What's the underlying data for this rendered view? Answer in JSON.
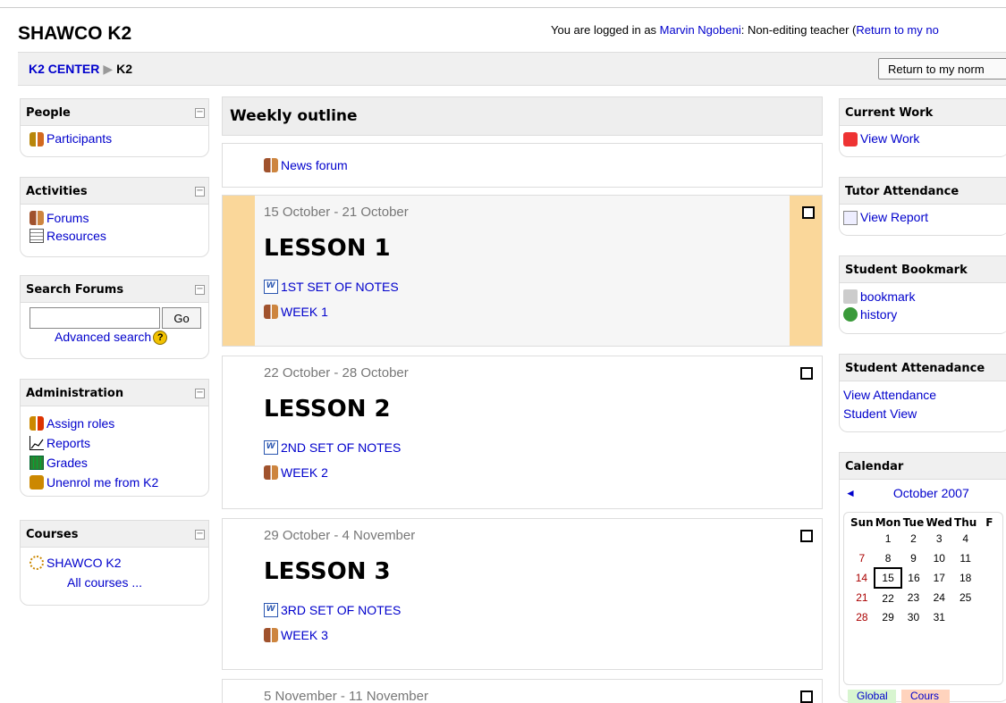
{
  "header": {
    "site_title": "SHAWCO K2",
    "login_prefix": "You are logged in as ",
    "login_user": "Marvin Ngobeni",
    "login_role": ": Non-editing teacher (",
    "login_return": "Return to my no"
  },
  "nav": {
    "breadcrumb_home": "K2 CENTER",
    "breadcrumb_sep": "▶",
    "breadcrumb_current": "K2",
    "return_button": "Return to my norm"
  },
  "people": {
    "title": "People",
    "participants": "Participants",
    "toggle": "−"
  },
  "activities": {
    "title": "Activities",
    "forums": "Forums",
    "resources": "Resources",
    "toggle": "−"
  },
  "search_forums": {
    "title": "Search Forums",
    "go": "Go",
    "advanced": "Advanced search",
    "help": "?",
    "toggle": "−",
    "value": ""
  },
  "administration": {
    "title": "Administration",
    "assign_roles": "Assign roles",
    "reports": "Reports",
    "grades": "Grades",
    "unenrol": "Unenrol me from K2",
    "toggle": "−"
  },
  "courses": {
    "title": "Courses",
    "course": "SHAWCO K2",
    "all": "All courses ...",
    "toggle": "−"
  },
  "main": {
    "outline_title": "Weekly outline",
    "news_forum": "News forum",
    "sections": [
      {
        "date": "15 October - 21 October",
        "title": "LESSON 1",
        "notes": "1ST SET OF NOTES",
        "week": "WEEK 1"
      },
      {
        "date": "22 October - 28 October",
        "title": "LESSON 2",
        "notes": "2ND SET OF NOTES",
        "week": "WEEK 2"
      },
      {
        "date": "29 October - 4 November",
        "title": "LESSON 3",
        "notes": "3RD SET OF NOTES",
        "week": "WEEK 3"
      },
      {
        "date": "5 November - 11 November"
      }
    ]
  },
  "right": {
    "current_work": {
      "title": "Current Work",
      "link": "View Work"
    },
    "tutor_attendance": {
      "title": "Tutor Attendance",
      "link": "View Report"
    },
    "student_bookmark": {
      "title": "Student Bookmark",
      "bookmark": "bookmark",
      "history": "history"
    },
    "student_attendance": {
      "title": "Student Attenadance",
      "view": "View Attendance",
      "student_view": "Student View"
    },
    "calendar": {
      "title": "Calendar",
      "prev": "◄",
      "month": "October 2007",
      "days": [
        "Sun",
        "Mon",
        "Tue",
        "Wed",
        "Thu",
        "F"
      ],
      "weeks": [
        [
          "",
          "1",
          "2",
          "3",
          "4",
          ""
        ],
        [
          "7",
          "8",
          "9",
          "10",
          "11",
          ""
        ],
        [
          "14",
          "15",
          "16",
          "17",
          "18",
          ""
        ],
        [
          "21",
          "22",
          "23",
          "24",
          "25",
          ""
        ],
        [
          "28",
          "29",
          "30",
          "31",
          "",
          ""
        ]
      ],
      "legend_global": "Global",
      "legend_course": "Cours"
    }
  },
  "colors": {
    "current_week": "#fad79a",
    "link": "#0000cc"
  }
}
